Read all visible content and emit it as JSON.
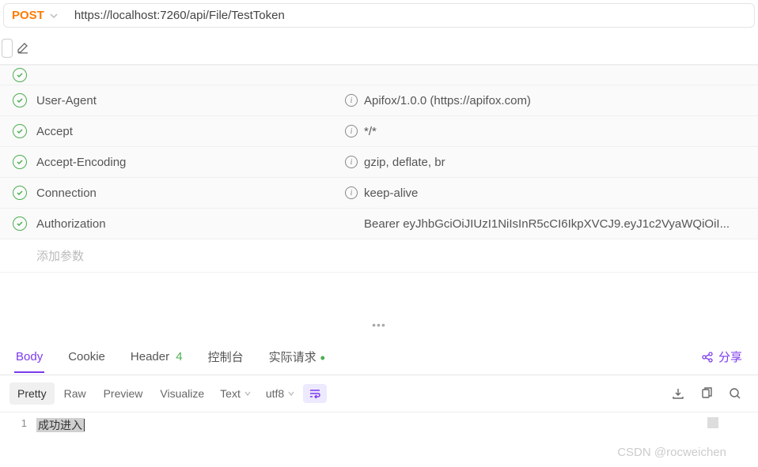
{
  "request": {
    "method": "POST",
    "url": "https://localhost:7260/api/File/TestToken"
  },
  "headers": [
    {
      "enabled": true,
      "key": "User-Agent",
      "info": true,
      "value": "Apifox/1.0.0 (https://apifox.com)"
    },
    {
      "enabled": true,
      "key": "Accept",
      "info": true,
      "value": "*/*"
    },
    {
      "enabled": true,
      "key": "Accept-Encoding",
      "info": true,
      "value": "gzip, deflate, br"
    },
    {
      "enabled": true,
      "key": "Connection",
      "info": true,
      "value": "keep-alive"
    },
    {
      "enabled": true,
      "key": "Authorization",
      "info": false,
      "value": "Bearer eyJhbGciOiJIUzI1NiIsInR5cCI6IkpXVCJ9.eyJ1c2VyaWQiOiI..."
    }
  ],
  "add_param_placeholder": "添加参数",
  "response_tabs": {
    "body": "Body",
    "cookie": "Cookie",
    "header": "Header",
    "header_count": "4",
    "console": "控制台",
    "actual_request": "实际请求",
    "share": "分享"
  },
  "format_bar": {
    "pretty": "Pretty",
    "raw": "Raw",
    "preview": "Preview",
    "visualize": "Visualize",
    "type": "Text",
    "encoding": "utf8"
  },
  "response_body": {
    "line_number": "1",
    "content": "成功进入"
  },
  "watermark": "CSDN @rocweichen"
}
